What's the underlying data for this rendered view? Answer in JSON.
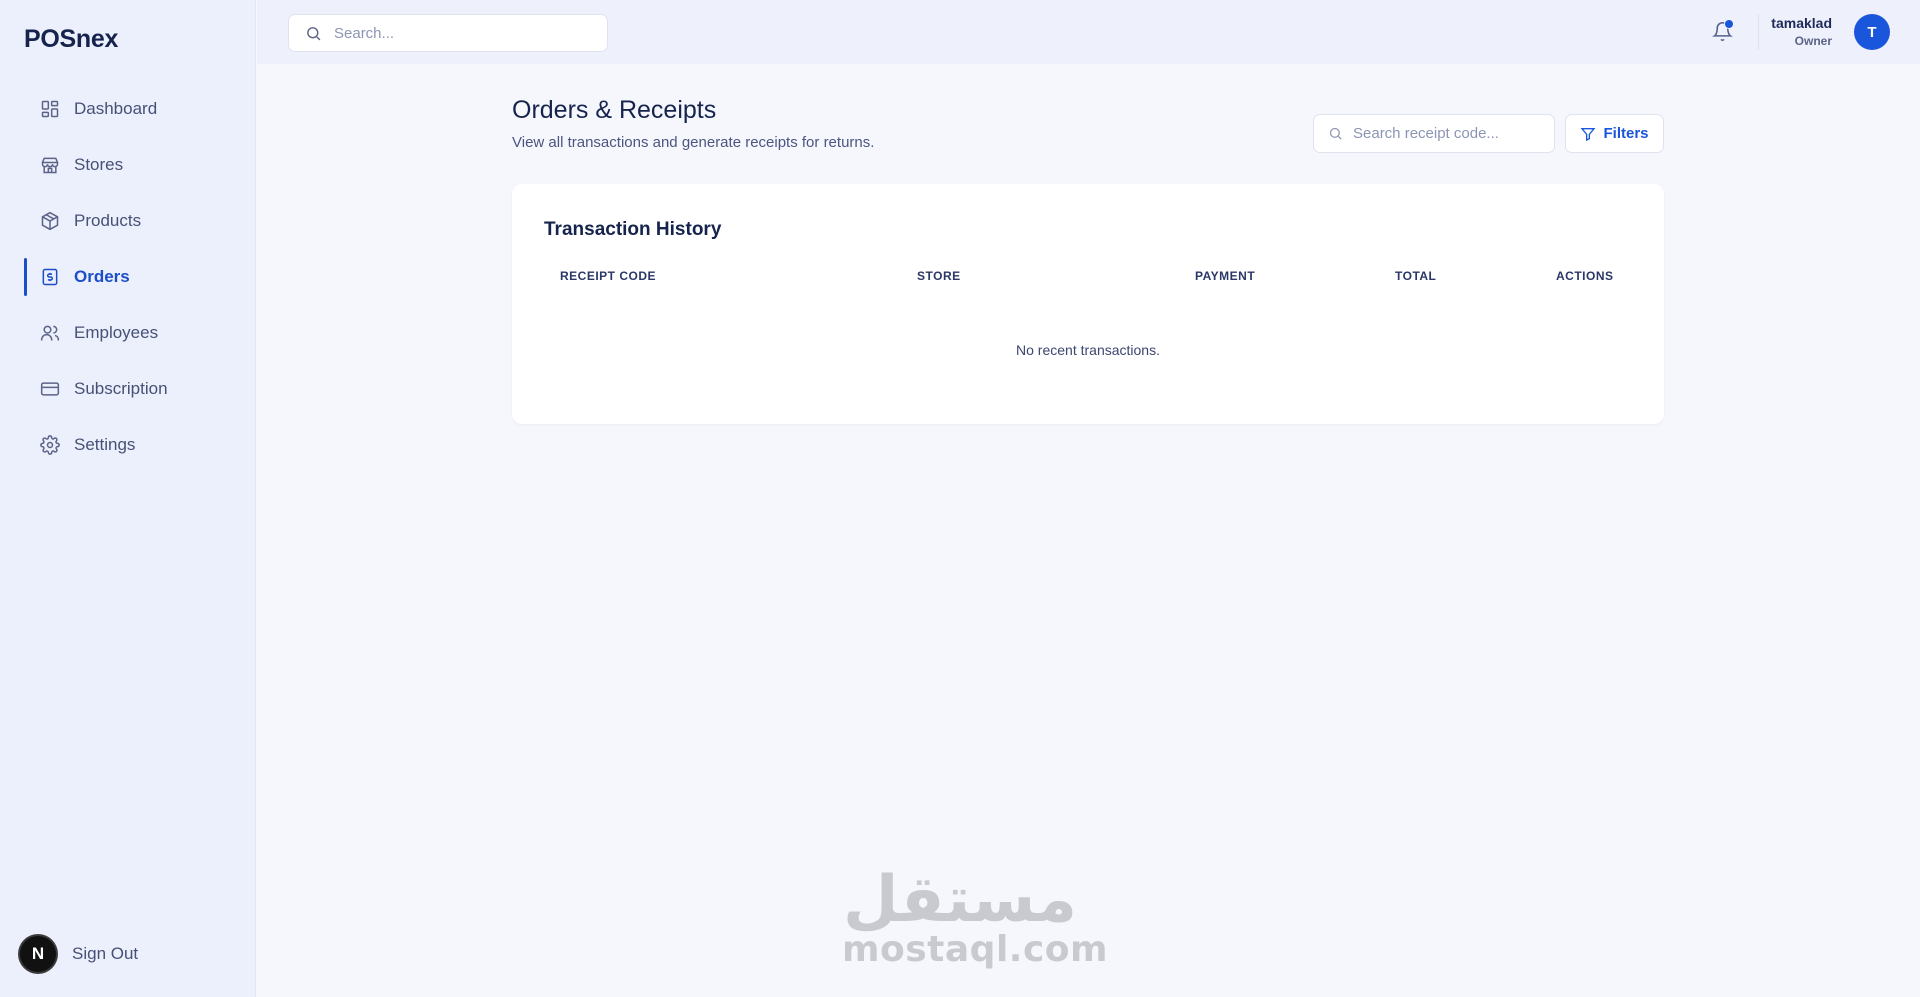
{
  "sidebar": {
    "logo": "POSnex",
    "items": [
      {
        "label": "Dashboard",
        "icon": "grid-icon"
      },
      {
        "label": "Stores",
        "icon": "store-icon"
      },
      {
        "label": "Products",
        "icon": "box-icon"
      },
      {
        "label": "Orders",
        "icon": "receipt-icon",
        "active": true
      },
      {
        "label": "Employees",
        "icon": "users-icon"
      },
      {
        "label": "Subscription",
        "icon": "credit-card-icon"
      },
      {
        "label": "Settings",
        "icon": "gear-icon"
      }
    ],
    "signout": {
      "badge": "N",
      "label": "Sign Out"
    }
  },
  "topbar": {
    "search_placeholder": "Search...",
    "user": {
      "name": "tamaklad",
      "role": "Owner",
      "initial": "T"
    }
  },
  "main": {
    "title": "Orders & Receipts",
    "subtitle": "View all transactions and generate receipts for returns.",
    "receipt_search_placeholder": "Search receipt code...",
    "filters_label": "Filters",
    "card": {
      "title": "Transaction History",
      "columns": [
        "RECEIPT CODE",
        "STORE",
        "PAYMENT",
        "TOTAL",
        "ACTIONS"
      ],
      "empty_text": "No recent transactions."
    }
  },
  "watermark": {
    "arabic": "مستقل",
    "latin": "mostaql.com"
  },
  "colors": {
    "accent": "#1a56db",
    "sidebar_bg": "#eceffc",
    "page_bg": "#f6f7fd"
  }
}
